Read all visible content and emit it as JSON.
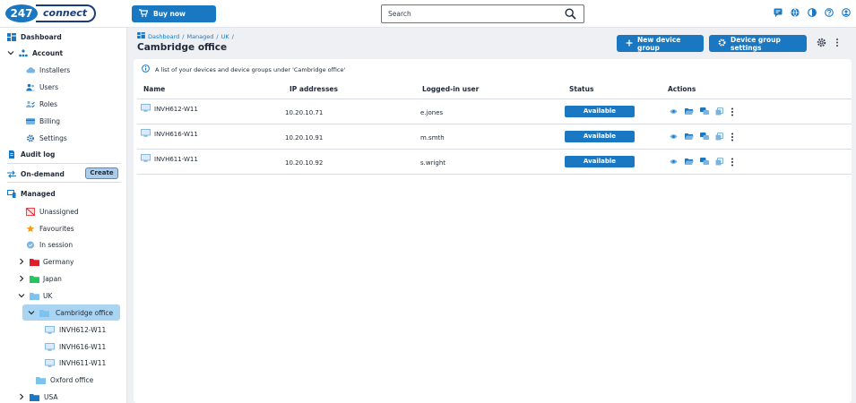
{
  "brand": {
    "number": "247",
    "name": "connect"
  },
  "topbar": {
    "buy_label": "Buy now",
    "search_placeholder": "Search",
    "icons": [
      "chat-icon",
      "globe-icon",
      "contrast-icon",
      "help-icon",
      "account-icon"
    ]
  },
  "sidebar": {
    "dashboard": "Dashboard",
    "account": "Account",
    "account_items": [
      "Installers",
      "Users",
      "Roles",
      "Billing",
      "Settings"
    ],
    "audit_log": "Audit log",
    "on_demand": "On-demand",
    "create_label": "Create",
    "managed": "Managed",
    "managed_items": [
      "Unassigned",
      "Favourites",
      "In session"
    ],
    "groups": [
      {
        "label": "Germany",
        "color": "#e11d2a"
      },
      {
        "label": "Japan",
        "color": "#22c55e"
      },
      {
        "label": "UK",
        "color": "#7cc4ef"
      }
    ],
    "uk_children": {
      "selected": "Cambridge office",
      "devices": [
        "INVH612-W11",
        "INVH616-W11",
        "INVH611-W11"
      ],
      "other": "Oxford office"
    },
    "usa": "USA"
  },
  "main": {
    "breadcrumb": [
      "Dashboard",
      "Managed",
      "UK"
    ],
    "breadcrumb_sep": "/",
    "title": "Cambridge office",
    "new_group_label": "New device group",
    "group_settings_label": "Device group settings",
    "info_text": "A list of your devices and device groups under 'Cambridge office'",
    "columns": [
      "Name",
      "IP addresses",
      "Logged-in user",
      "Status",
      "Actions"
    ],
    "rows": [
      {
        "name": "INVH612-W11",
        "ip": "10.20.10.71",
        "user": "e.jones",
        "status": "Available"
      },
      {
        "name": "INVH616-W11",
        "ip": "10.20.10.91",
        "user": "m.smth",
        "status": "Available"
      },
      {
        "name": "INVH611-W11",
        "ip": "10.20.10.92",
        "user": "s.wright",
        "status": "Available"
      }
    ]
  },
  "colors": {
    "accent": "#1a78c2",
    "selected": "#a9d4f2"
  }
}
